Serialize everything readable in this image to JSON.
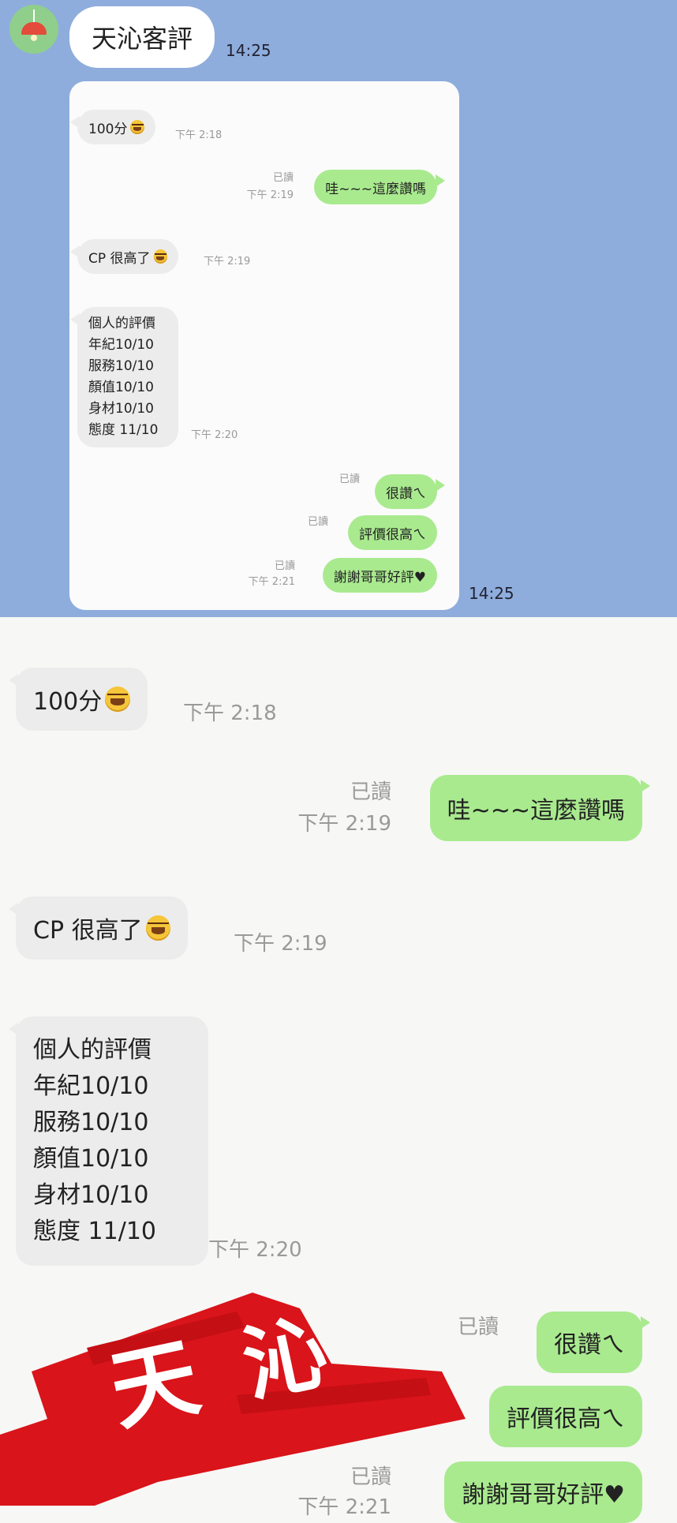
{
  "header": {
    "chat_title": "天沁客評",
    "time": "14:25",
    "bottom_time": "14:25"
  },
  "messages": [
    {
      "side": "in",
      "text": "100分",
      "emoji": true,
      "time": "下午 2:18"
    },
    {
      "side": "out",
      "text": "哇~~~這麼讚嗎",
      "read": "已讀",
      "time": "下午 2:19"
    },
    {
      "side": "in",
      "text": "CP 很高了",
      "emoji": true,
      "time": "下午 2:19"
    },
    {
      "side": "in",
      "lines": [
        "個人的評價",
        "年紀10/10",
        "服務10/10",
        "顏值10/10",
        "身材10/10",
        "態度 11/10"
      ],
      "time": "下午 2:20"
    },
    {
      "side": "out",
      "text": "很讚ㄟ",
      "read": "已讀"
    },
    {
      "side": "out",
      "text": "評價很高ㄟ",
      "read": "已讀"
    },
    {
      "side": "out",
      "text": "謝謝哥哥好評♥",
      "read": "已讀",
      "time": "下午 2:21"
    }
  ],
  "stamp": {
    "text": "天 沁",
    "color": "#d9141a"
  },
  "colors": {
    "top_bg": "#8eaddc",
    "incoming": "#ececec",
    "outgoing": "#a9ea8f",
    "page": "#f7f7f5"
  }
}
